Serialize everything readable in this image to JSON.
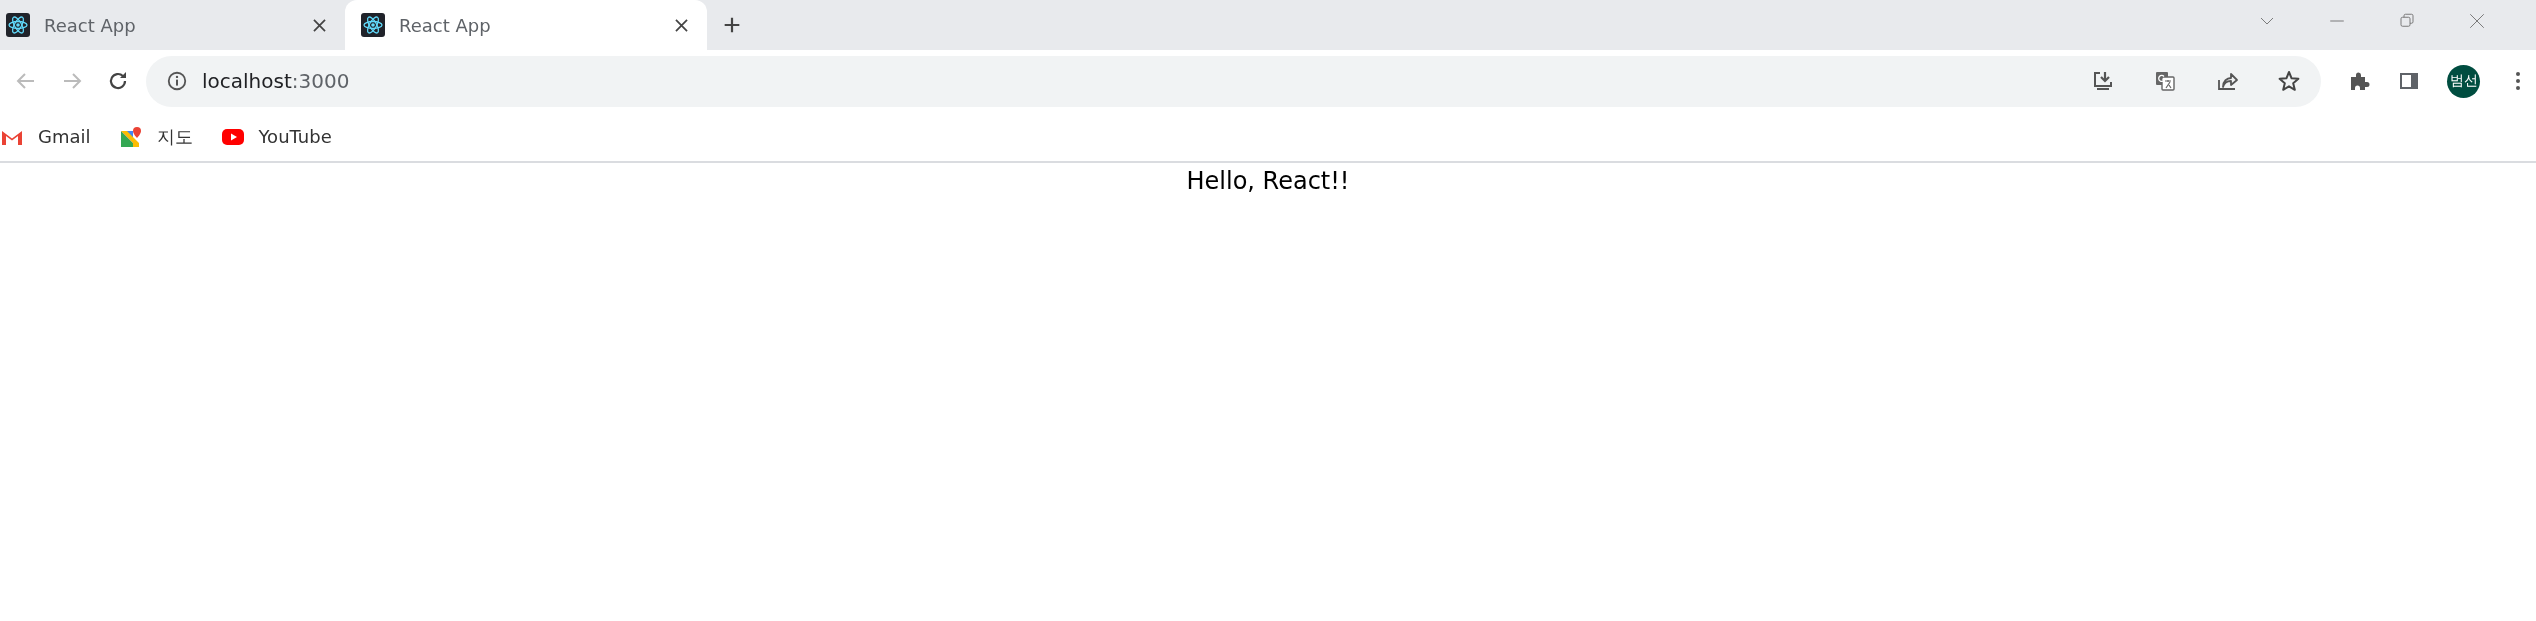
{
  "tabs": [
    {
      "title": "React App",
      "selected": false
    },
    {
      "title": "React App",
      "selected": true
    }
  ],
  "address_bar": {
    "host": "localhost",
    "port": ":3000"
  },
  "profile": {
    "initials": "범선"
  },
  "bookmarks": [
    {
      "kind": "gmail",
      "label": "Gmail"
    },
    {
      "kind": "maps",
      "label": "지도"
    },
    {
      "kind": "youtube",
      "label": "YouTube"
    }
  ],
  "page": {
    "text": "Hello, React!!"
  }
}
